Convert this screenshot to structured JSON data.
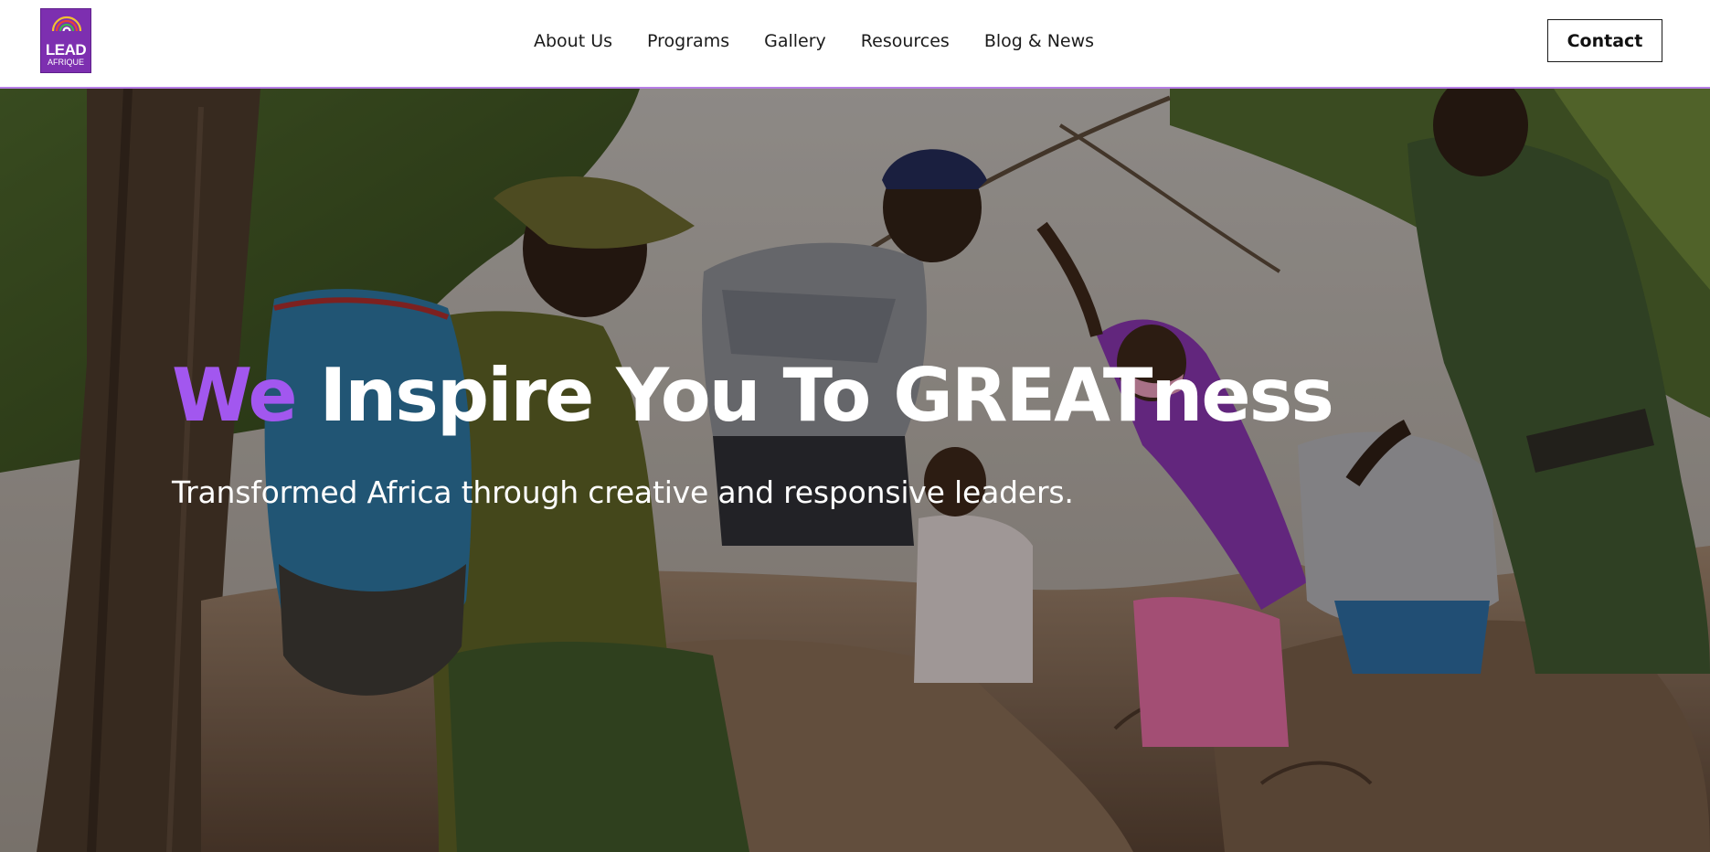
{
  "header": {
    "logo": {
      "word": "LEAD",
      "sub": "AFRIQUE"
    },
    "nav": [
      {
        "label": "About Us"
      },
      {
        "label": "Programs"
      },
      {
        "label": "Gallery"
      },
      {
        "label": "Resources"
      },
      {
        "label": "Blog & News"
      }
    ],
    "contact_label": "Contact"
  },
  "hero": {
    "headline_accent": "We",
    "headline_rest": "Inspire You To GREATness",
    "subline": "Transformed Africa through creative and responsive leaders."
  },
  "colors": {
    "accent": "#a257ef",
    "logo_bg": "#7d2fb0",
    "header_border": "#b77ee6",
    "text_dark": "#1b1b1b"
  }
}
